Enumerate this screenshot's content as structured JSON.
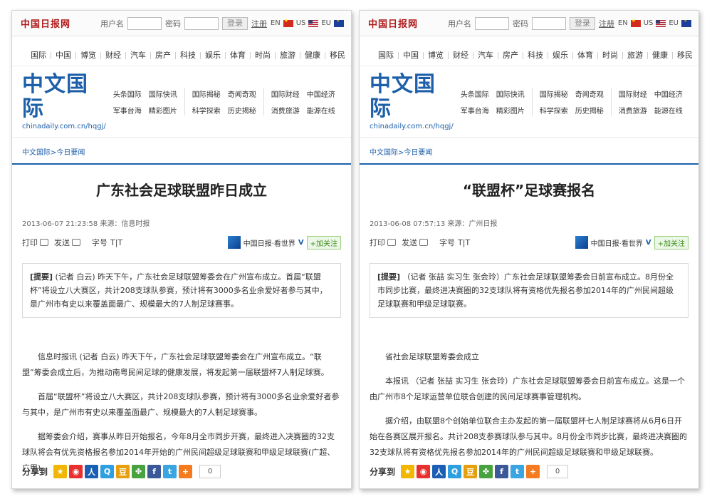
{
  "common": {
    "logo": "中国日报网",
    "login": {
      "user_label": "用户名",
      "pass_label": "密码",
      "login_button": "登录",
      "register_link": "注册"
    },
    "languages": [
      {
        "code": "EN",
        "flag": "cn"
      },
      {
        "code": "US",
        "flag": "us"
      },
      {
        "code": "EU",
        "flag": "eu"
      }
    ],
    "nav_items": [
      "国际",
      "中国",
      "博览",
      "财经",
      "汽车",
      "房产",
      "科技",
      "娱乐",
      "体育",
      "时尚",
      "旅游",
      "健康",
      "移民"
    ],
    "brand": {
      "title": "中文国际",
      "url": "chinadaily.com.cn/hqgj/"
    },
    "link_groups": [
      [
        "头条国际",
        "国际快讯",
        "军事台海",
        "精彩图片"
      ],
      [
        "国际揭秘",
        "奇闻奇观",
        "科学探索",
        "历史揭秘"
      ],
      [
        "国际财经",
        "中国经济",
        "消费旅游",
        "能源在线"
      ]
    ],
    "breadcrumb": {
      "home": "中文国际",
      "sep": ">",
      "section": "今日要闻"
    },
    "tools": {
      "print": "打印",
      "send": "发送",
      "size": "字号",
      "size_controls": "T|T"
    },
    "weibo": {
      "name": "中国日报·看世界",
      "v": "V",
      "follow": "+加关注"
    },
    "share": {
      "label": "分享到",
      "count": "0"
    },
    "share_icons": [
      {
        "name": "qzone-icon",
        "glyph": "★",
        "color": "#f2b705"
      },
      {
        "name": "sina-weibo-icon",
        "glyph": "◉",
        "color": "#e8312f"
      },
      {
        "name": "renren-icon",
        "glyph": "人",
        "color": "#1a5fb4"
      },
      {
        "name": "tencent-weibo-icon",
        "glyph": "Q",
        "color": "#2e9fe0"
      },
      {
        "name": "douban-icon",
        "glyph": "豆",
        "color": "#e6a00d"
      },
      {
        "name": "kaixin-icon",
        "glyph": "✤",
        "color": "#47a23f"
      },
      {
        "name": "facebook-icon",
        "glyph": "f",
        "color": "#3b5998"
      },
      {
        "name": "twitter-icon",
        "glyph": "t",
        "color": "#3aa5e0"
      },
      {
        "name": "more-share-icon",
        "glyph": "+",
        "color": "#f47b20"
      }
    ]
  },
  "articles": [
    {
      "title": "广东社会足球联盟昨日成立",
      "meta": "2013-06-07 21:23:58 来源：信息时报",
      "summary_label": "[提要]",
      "summary": " (记者 白云) 昨天下午，广东社会足球联盟筹委会在广州宣布成立。首届“联盟杯”将设立八大赛区，共计208支球队参赛，预计将有3000多名业余爱好者参与其中，是广州市有史以来覆盖面最广、规模最大的7人制足球赛事。",
      "paragraphs": [
        "信息时报讯 (记者 白云) 昨天下午，广东社会足球联盟筹委会在广州宣布成立。“联盟”筹委会成立后，为推动南粤民间足球的健康发展，将发起第一届联盟杯7人制足球赛。",
        "首届“联盟杯”将设立八大赛区，共计208支球队参赛，预计将有3000多名业余爱好者参与其中，是广州市有史以来覆盖面最广、规模最大的7人制足球赛事。",
        "据筹委会介绍，赛事从昨日开始报名，今年8月全市同步开赛，最终进入决赛圈的32支球队将会有优先资格报名参加2014年开始的广州民间超级足球联赛和甲级足球联赛(广超、广甲)。"
      ]
    },
    {
      "title": "“联盟杯”足球赛报名",
      "meta": "2013-06-08 07:57:13 来源：广州日报",
      "summary_label": "[提要]",
      "summary": " （记者 张喆 实习生 张会玲）广东社会足球联盟筹委会日前宣布成立。8月份全市同步比赛，最终进决赛圈的32支球队将有资格优先报名参加2014年的广州民间超级足球联赛和甲级足球联赛。",
      "paragraphs": [
        "省社会足球联盟筹委会成立",
        "本报讯 （记者 张喆 实习生 张会玲）广东社会足球联盟筹委会日前宣布成立。这是一个由广州市8个足球运营单位联合创建的民间足球赛事管理机构。",
        "据介绍，由联盟8个创始单位联合主办发起的第一届联盟杯七人制足球赛将从6月6日开始在各赛区展开报名。共计208支参赛球队参与其中。8月份全市同步比赛，最终进决赛圈的32支球队将有资格优先报名参加2014年的广州民间超级足球联赛和甲级足球联赛。"
      ]
    }
  ]
}
